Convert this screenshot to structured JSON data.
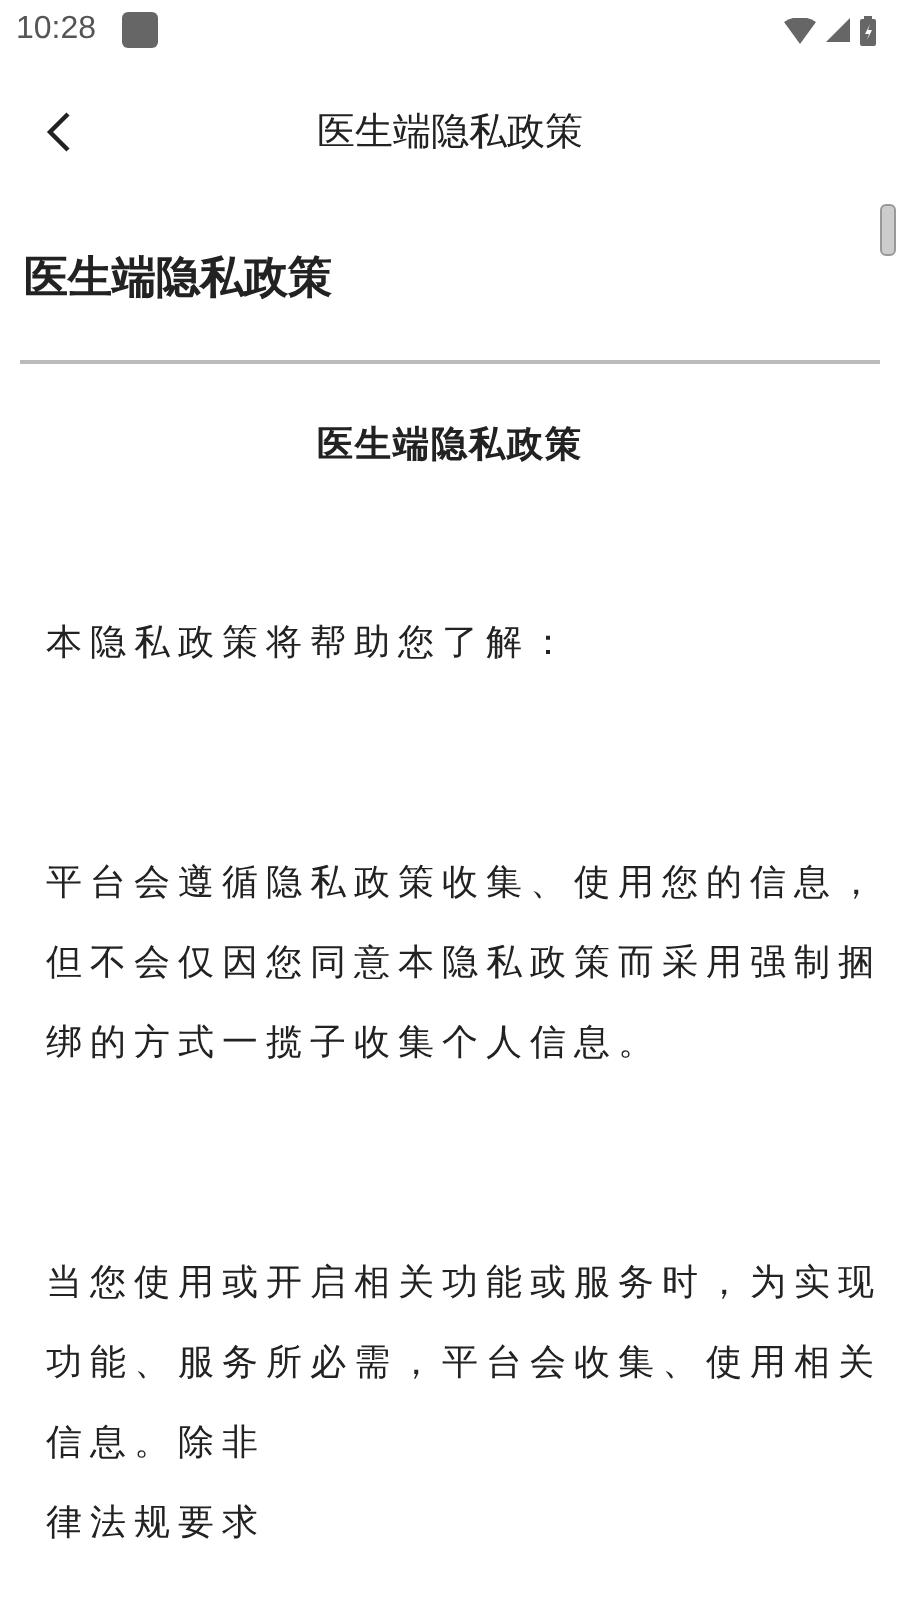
{
  "status_bar": {
    "time": "10:28"
  },
  "app_bar": {
    "title": "医生端隐私政策"
  },
  "page": {
    "heading": "医生端隐私政策",
    "doc_title": "医生端隐私政策",
    "paragraphs": [
      [
        "本隐私政策将帮助您了解："
      ],
      [
        "平台会遵循隐私政策收集、使用您的信息，",
        "但不会仅因您同意本隐私政策而采用强制捆",
        "绑的方式一揽子收集个人信息。"
      ],
      [
        "当您使用或开启相关功能或服务时，为实现",
        "功能、服务所必需，平台会收集、使用相关",
        "信息。除非",
        "律法规要求"
      ]
    ]
  }
}
